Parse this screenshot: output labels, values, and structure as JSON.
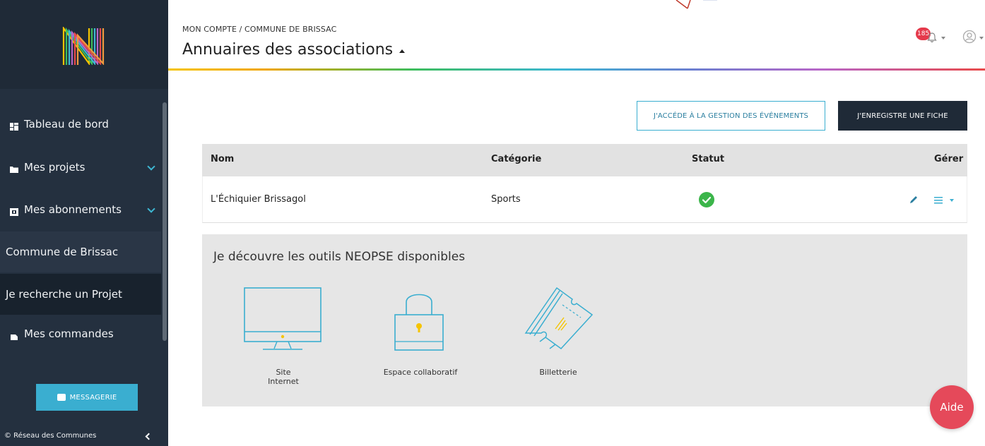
{
  "colors": {
    "sidebar": "#24303f",
    "accent": "#3aaed0",
    "dark_button": "#1f2a37",
    "status_ok": "#3bb54a",
    "aide": "#e5495a",
    "badge": "#e5394b"
  },
  "sidebar": {
    "items": [
      {
        "label": "Tableau de bord",
        "icon": "dashboard-icon"
      },
      {
        "label": "Mes projets",
        "icon": "folder-icon"
      },
      {
        "label": "Mes abonnements",
        "icon": "subscriptions-icon"
      },
      {
        "label": "Commune de Brissac"
      },
      {
        "label": "Je recherche un Projet"
      },
      {
        "label": "Mes commandes",
        "icon": "orders-icon"
      }
    ],
    "messagerie_label": "MESSAGERIE",
    "footer": "© Réseau des Communes"
  },
  "header": {
    "breadcrumb": "MON COMPTE / COMMUNE DE BRISSAC",
    "title": "Annuaires des associations",
    "notifications_count": "185"
  },
  "actions": {
    "events_button": "J'ACCÉDE À LA GESTION DES ÉVÉNEMENTS",
    "register_button": "J'ENREGISTRE UNE FICHE"
  },
  "table": {
    "columns": [
      "Nom",
      "Catégorie",
      "Statut",
      "Gérer"
    ],
    "rows": [
      {
        "nom": "L'Échiquier Brissagol",
        "categorie": "Sports",
        "statut": "ok"
      }
    ]
  },
  "tools": {
    "title": "Je découvre les outils NEOPSE disponibles",
    "items": [
      {
        "label": "Site Internet",
        "icon": "monitor-icon"
      },
      {
        "label": "Espace collaboratif",
        "icon": "padlock-icon"
      },
      {
        "label": "Billetterie",
        "icon": "tickets-icon"
      }
    ]
  },
  "help_label": "Aide"
}
